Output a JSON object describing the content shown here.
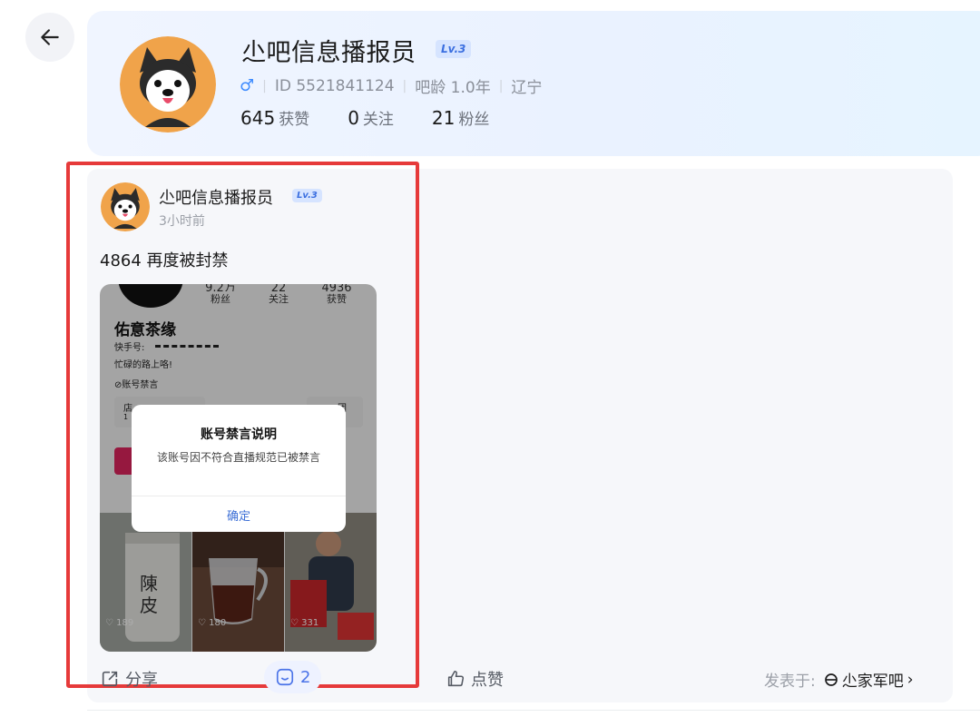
{
  "header": {
    "back_icon": "arrow-left-icon"
  },
  "profile": {
    "name": "尐吧信息播报员",
    "level": "Lv.3",
    "gender_icon": "male-icon",
    "gender_symbol": "♂",
    "id_text": "ID 5521841124",
    "age_text": "吧龄 1.0年",
    "location": "辽宁",
    "stats": [
      {
        "value": "645",
        "label": "获赞"
      },
      {
        "value": "0",
        "label": "关注"
      },
      {
        "value": "21",
        "label": "粉丝"
      }
    ]
  },
  "post": {
    "author": "尐吧信息播报员",
    "level": "Lv.3",
    "time": "3小时前",
    "text": "4864 再度被封禁",
    "image": {
      "stats": [
        {
          "value": "9.2万",
          "label": "粉丝"
        },
        {
          "value": "22",
          "label": "关注"
        },
        {
          "value": "4936",
          "label": "获赞"
        }
      ],
      "name": "佑意茶缘",
      "kuaishou_label": "快手号:",
      "bio": "忙碌的路上咯!",
      "ban_tag": "⊘账号禁言",
      "box_texts": [
        "店",
        "1",
        "团",
        "特权"
      ],
      "dialog": {
        "title": "账号禁言说明",
        "body": "该账号因不符合直播规范已被禁言",
        "button": "确定"
      },
      "thumbs": [
        {
          "likes": "♡ 189",
          "label": "陳皮"
        },
        {
          "likes": "♡ 180"
        },
        {
          "likes": "♡ 331"
        }
      ]
    },
    "actions": {
      "share": "分享",
      "comment_count": "2",
      "like": "点赞",
      "posted_in_label": "发表于:",
      "forum_name": "尐家军吧",
      "forum_chevron": "›"
    }
  },
  "colors": {
    "highlight_border": "#e63a3a",
    "accent_blue": "#3b6fe0",
    "level_badge_bg": "#d6e4ff"
  }
}
